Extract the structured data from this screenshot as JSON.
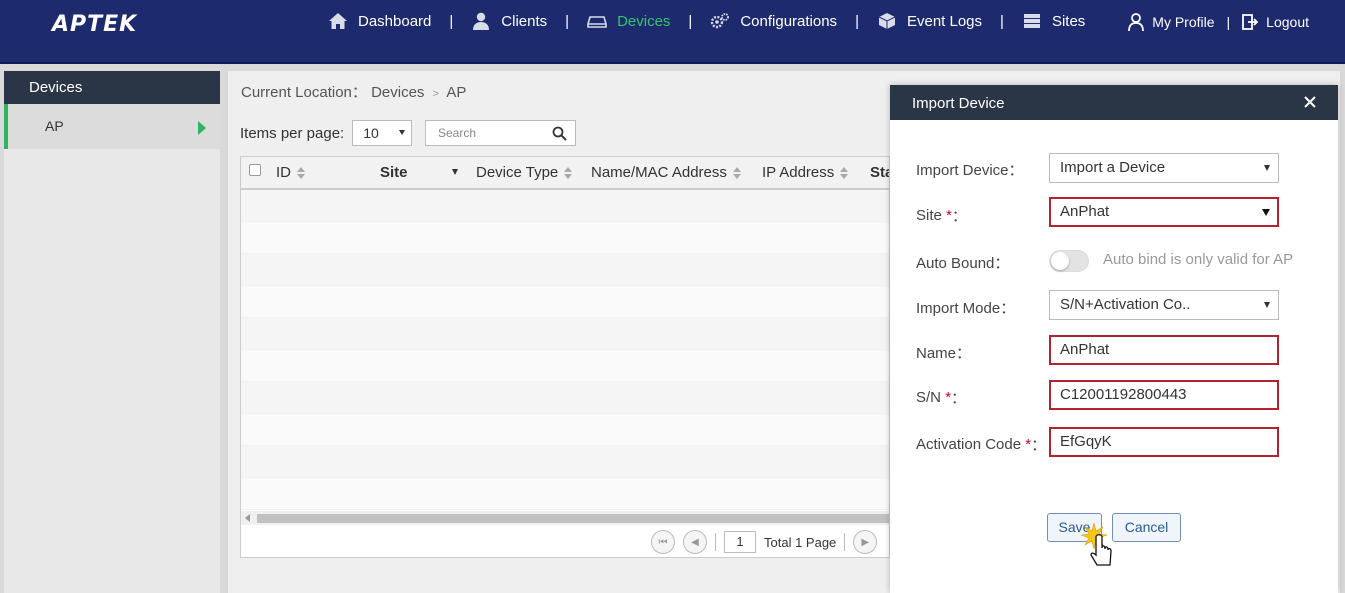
{
  "brand": {
    "logo": "APTEK"
  },
  "nav": {
    "items": [
      {
        "label": "Dashboard",
        "icon": "home-icon"
      },
      {
        "label": "Clients",
        "icon": "user-icon"
      },
      {
        "label": "Devices",
        "icon": "device-icon",
        "active": true
      },
      {
        "label": "Configurations",
        "icon": "gears-icon"
      },
      {
        "label": "Event Logs",
        "icon": "cube-icon"
      },
      {
        "label": "Sites",
        "icon": "server-icon"
      }
    ],
    "separator": "|",
    "user": {
      "profile": "My Profile",
      "logout": "Logout"
    },
    "active_color": "#32c56a"
  },
  "sidebar": {
    "title": "Devices",
    "items": [
      {
        "label": "AP"
      }
    ]
  },
  "breadcrumb": {
    "prefix": "Current Location：",
    "parts": [
      "Devices",
      "AP"
    ],
    "sep": ">"
  },
  "toolbar": {
    "items_per_page_label": "Items per page:",
    "items_per_page_value": "10",
    "search_placeholder": "Search"
  },
  "table": {
    "columns": [
      "ID",
      "Site",
      "Device Type",
      "Name/MAC Address",
      "IP Address",
      "Sta"
    ],
    "rows": []
  },
  "pager": {
    "page": "1",
    "total": "Total 1 Page"
  },
  "modal": {
    "title": "Import Device",
    "fields": {
      "import_device": {
        "label": "Import Device：",
        "value": "Import a Device"
      },
      "site": {
        "label": "Site",
        "req": "*",
        "colon": "：",
        "value": "AnPhat"
      },
      "auto_bound": {
        "label": "Auto Bound：",
        "hint": "Auto bind is only valid for AP"
      },
      "import_mode": {
        "label": "Import Mode：",
        "value": "S/N+Activation Co.."
      },
      "name": {
        "label": "Name：",
        "value": "AnPhat"
      },
      "sn": {
        "label": "S/N",
        "req": "*",
        "colon": "：",
        "value": "C12001192800443"
      },
      "activation": {
        "label": "Activation Code",
        "req": "*",
        "colon": "：",
        "value": "EfGqyK"
      }
    },
    "save": "Save",
    "cancel": "Cancel",
    "error_color": "#b3222e"
  }
}
